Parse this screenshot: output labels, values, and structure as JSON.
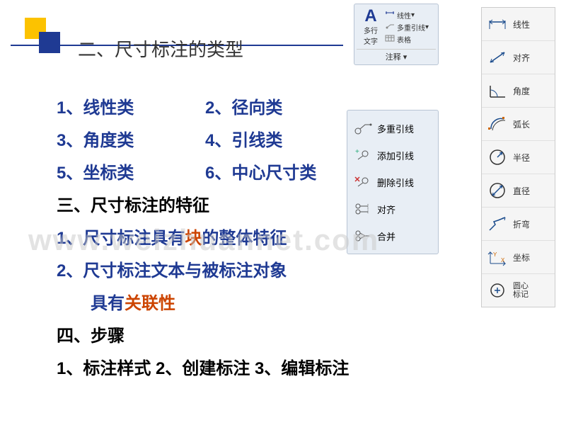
{
  "title": "二、尺寸标注的类型",
  "types": {
    "item1": "1、线性类",
    "item2": "2、径向类",
    "item3": "3、角度类",
    "item4": "4、引线类",
    "item5": "5、坐标类",
    "item6": "6、中心尺寸类"
  },
  "section3": "三、尺寸标注的特征",
  "feature1_pre": "1、尺寸标注具有",
  "feature1_red": "块",
  "feature1_post": "的整体特征",
  "feature2_line1": "2、尺寸标注文本与被标注对象",
  "feature2_pre": "具有",
  "feature2_red": "关联性",
  "section4": "四、步骤",
  "steps": "1、标注样式 2、创建标注 3、编辑标注",
  "watermark": "www.weizhuannet.com",
  "ribbon": {
    "mtext_top": "多行",
    "mtext_bottom": "文字",
    "linear": "线性",
    "mleader": "多重引线",
    "table": "表格",
    "footer": "注释"
  },
  "leader_panel": {
    "item1": "多重引线",
    "item2": "添加引线",
    "item3": "删除引线",
    "item4": "对齐",
    "item5": "合并"
  },
  "toolbar": {
    "linear": "线性",
    "aligned": "对齐",
    "angular": "角度",
    "arc": "弧长",
    "radius": "半径",
    "diameter": "直径",
    "jogged": "折弯",
    "ordinate": "坐标",
    "center_l1": "圆心",
    "center_l2": "标记"
  }
}
